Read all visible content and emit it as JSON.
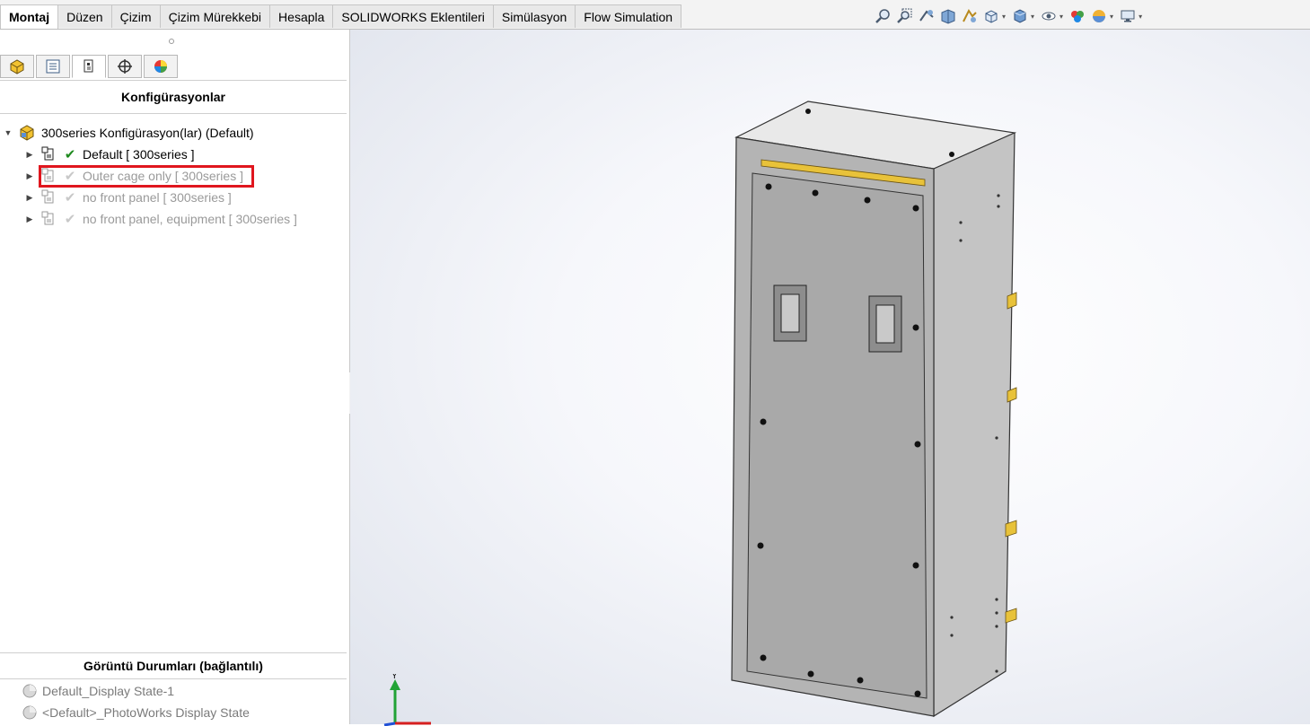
{
  "tabs": [
    "Montaj",
    "Düzen",
    "Çizim",
    "Çizim Mürekkebi",
    "Hesapla",
    "SOLIDWORKS Eklentileri",
    "Simülasyon",
    "Flow Simulation"
  ],
  "active_tab": "Montaj",
  "view_toolbar_icons": [
    "zoom-to-fit-icon",
    "zoom-to-area-icon",
    "previous-view-icon",
    "section-view-icon",
    "dynamic-annotation-icon",
    "view-orientation-icon",
    "display-style-icon",
    "hide-show-items-icon",
    "edit-appearance-icon",
    "apply-scene-icon",
    "view-settings-icon"
  ],
  "panel_tabs": [
    "feature-manager-icon",
    "property-manager-icon",
    "configuration-manager-icon",
    "dimxpert-manager-icon",
    "display-manager-icon"
  ],
  "panel": {
    "title": "Konfigürasyonlar",
    "root": {
      "label": "300series Konfigürasyon(lar)  (Default)"
    },
    "configurations": [
      {
        "label": "Default [ 300series ]",
        "active": true
      },
      {
        "label": "Outer cage only [ 300series ]",
        "active": false,
        "highlighted": true
      },
      {
        "label": "no front panel [ 300series ]",
        "active": false
      },
      {
        "label": "no front panel, equipment [ 300series ]",
        "active": false
      }
    ],
    "display_states_title": "Görüntü Durumları (bağlantılı)",
    "display_states": [
      "Default_Display State-1",
      "<Default>_PhotoWorks Display State"
    ]
  },
  "triad": {
    "y_label": "Y"
  },
  "colors": {
    "highlight_border": "#e0161e",
    "check_active": "#1e8a1e",
    "cabinet_face": "#a9a9a9",
    "cabinet_side": "#c4c4c4",
    "cabinet_top": "#e9e9e9",
    "bracket": "#e8c23a"
  }
}
